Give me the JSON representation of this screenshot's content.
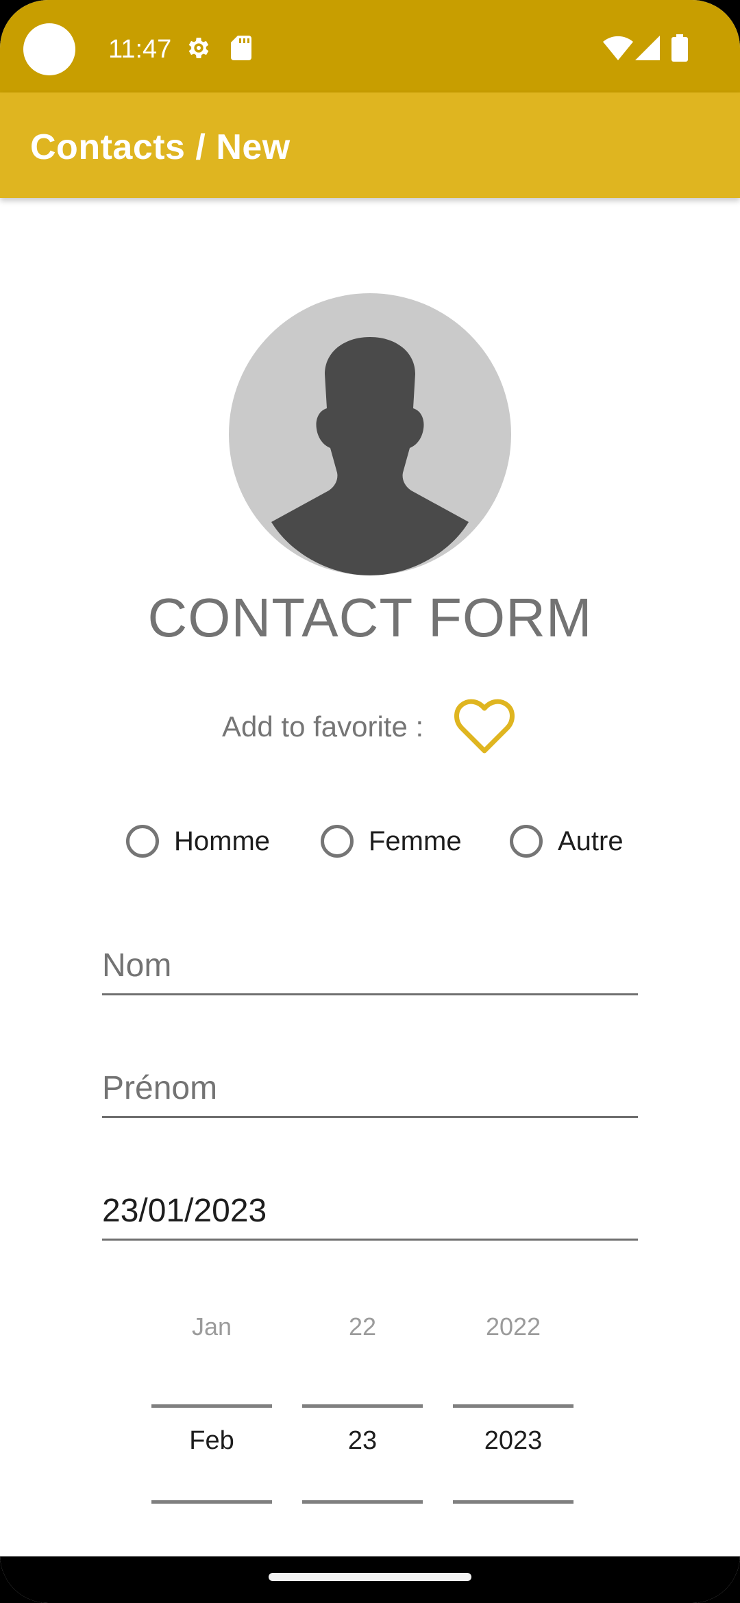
{
  "status_bar": {
    "time": "11:47",
    "icons": [
      "camera-cutout",
      "gear-icon",
      "sd-card-icon",
      "wifi-icon",
      "signal-icon",
      "battery-icon"
    ],
    "background": "#c89e00"
  },
  "app_bar": {
    "title": "Contacts / New",
    "background": "#dfb520"
  },
  "avatar": {
    "icon": "person-silhouette-icon"
  },
  "form": {
    "title": "CONTACT FORM",
    "favorite_label": "Add to favorite :",
    "favorite_icon": "heart-outline-icon",
    "accent": "#dfb520",
    "gender_options": [
      {
        "label": "Homme",
        "selected": false
      },
      {
        "label": "Femme",
        "selected": false
      },
      {
        "label": "Autre",
        "selected": false
      }
    ],
    "nom": {
      "value": "",
      "placeholder": "Nom"
    },
    "prenom": {
      "value": "",
      "placeholder": "Prénom"
    },
    "date": {
      "value": "23/01/2023"
    }
  },
  "date_picker": {
    "columns": [
      {
        "previous": "Jan",
        "current": "Feb"
      },
      {
        "previous": "22",
        "current": "23"
      },
      {
        "previous": "2022",
        "current": "2023"
      }
    ]
  },
  "nav_bar": {
    "icon": "home-handle"
  }
}
